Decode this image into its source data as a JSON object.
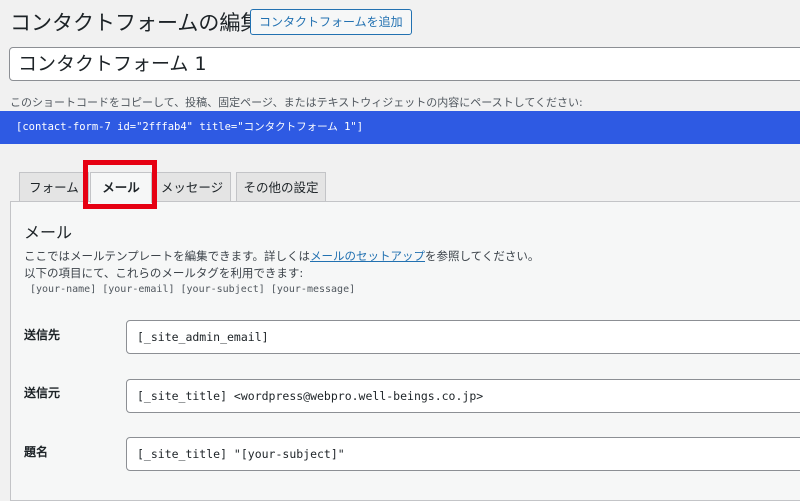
{
  "header": {
    "title": "コンタクトフォームの編集",
    "add_new_label": "コンタクトフォームを追加"
  },
  "form": {
    "title_value": "コンタクトフォーム 1"
  },
  "shortcode": {
    "description": "このショートコードをコピーして、投稿、固定ページ、またはテキストウィジェットの内容にペーストしてください:",
    "code": "[contact-form-7 id=\"2fffab4\" title=\"コンタクトフォーム 1\"]"
  },
  "tabs": [
    {
      "label": "フォーム",
      "active": false
    },
    {
      "label": "メール",
      "active": true
    },
    {
      "label": "メッセージ",
      "active": false
    },
    {
      "label": "その他の設定",
      "active": false
    }
  ],
  "mail_panel": {
    "heading": "メール",
    "desc_line1_before": "ここではメールテンプレートを編集できます。詳しくは",
    "desc_line1_link": "メールのセットアップ",
    "desc_line1_after": "を参照してください。",
    "desc_line2": "以下の項目にて、これらのメールタグを利用できます:",
    "mail_tags": "[your-name] [your-email] [your-subject] [your-message]",
    "fields": [
      {
        "label": "送信先",
        "value": "[_site_admin_email]"
      },
      {
        "label": "送信元",
        "value": "[_site_title] <wordpress@webpro.well-beings.co.jp>"
      },
      {
        "label": "題名",
        "value": "[_site_title] \"[your-subject]\""
      }
    ]
  },
  "colors": {
    "shortcode_bg": "#2e5ae3",
    "highlight": "#e60012",
    "link": "#2271b1"
  }
}
